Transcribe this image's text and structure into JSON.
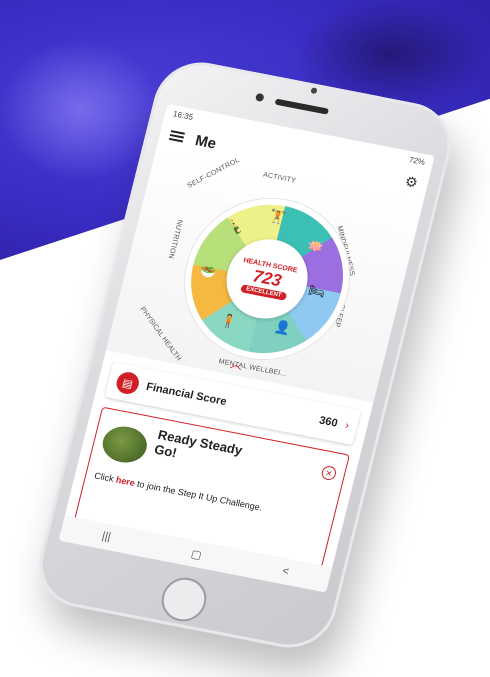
{
  "status": {
    "time": "16:35",
    "battery": "72%"
  },
  "app": {
    "title": "Me"
  },
  "health_score": {
    "label": "HEALTH SCORE",
    "value": "723",
    "rating": "EXCELLENT"
  },
  "segments": [
    {
      "label": "ACTIVITY",
      "icon": "exercise-icon"
    },
    {
      "label": "MINDFULNESS",
      "icon": "lotus-icon"
    },
    {
      "label": "SLEEP",
      "icon": "bed-icon"
    },
    {
      "label": "MENTAL WELLBEI...",
      "icon": "head-icon"
    },
    {
      "label": "PHYSICAL HEALTH",
      "icon": "body-icon"
    },
    {
      "label": "NUTRITION",
      "icon": "salad-bowl-icon"
    },
    {
      "label": "SELF-CONTROL",
      "icon": "bottle-icon"
    }
  ],
  "financial": {
    "label": "Financial Score",
    "value": "360",
    "arrow": "›"
  },
  "promo": {
    "title": "Ready Steady Go!",
    "body_prefix": "Click ",
    "link": "here",
    "body_suffix": " to join the Step It Up Challenge."
  },
  "navbar": {
    "recents": "|||",
    "home": "▢",
    "back": "<"
  },
  "colors": {
    "accent": "#d21f26",
    "background_top": "#3b2ec8"
  }
}
